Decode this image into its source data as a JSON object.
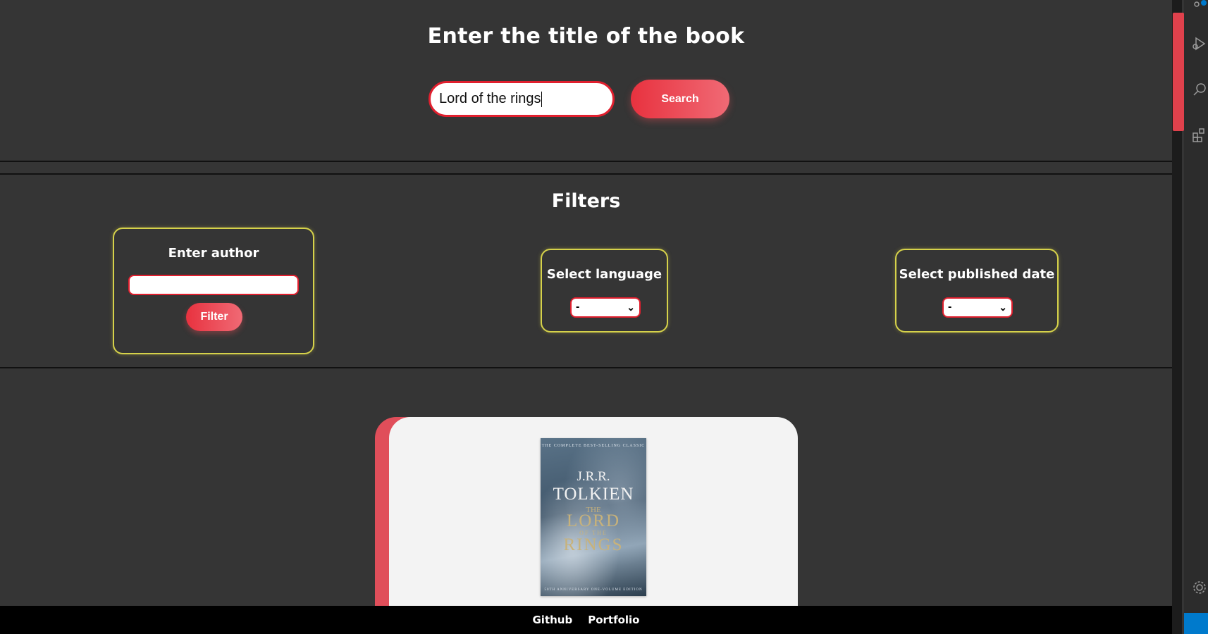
{
  "header": {
    "title": "Enter the title of the book",
    "search_value": "Lord of the rings",
    "search_button": "Search"
  },
  "filters": {
    "title": "Filters",
    "author": {
      "label": "Enter author",
      "value": "",
      "button": "Filter"
    },
    "language": {
      "label": "Select language",
      "selected": "-"
    },
    "published_date": {
      "label": "Select published date",
      "selected": "-"
    }
  },
  "results": [
    {
      "cover": {
        "tagline": "THE COMPLETE BEST-SELLING CLASSIC",
        "author_line1": "J.R.R.",
        "author_line2": "TOLKIEN",
        "title_the": "THE",
        "title_lord": "LORD",
        "title_of_the": "OF THE",
        "title_rings": "RINGS",
        "bottom_text": "50TH ANNIVERSARY ONE-VOLUME EDITION"
      }
    }
  ],
  "footer": {
    "links": [
      "Github",
      "Portfolio"
    ]
  },
  "colors": {
    "background": "#353535",
    "accent": "#e8323f",
    "filter_border": "#d6d24a",
    "footer": "#000000"
  }
}
